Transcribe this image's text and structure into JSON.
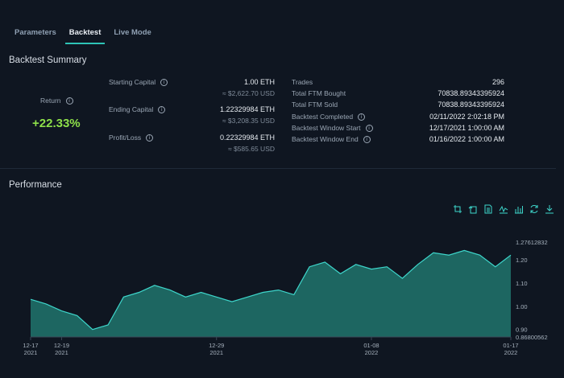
{
  "tabs": [
    {
      "label": "Parameters",
      "active": false
    },
    {
      "label": "Backtest",
      "active": true
    },
    {
      "label": "Live Mode",
      "active": false
    }
  ],
  "summary": {
    "title": "Backtest Summary",
    "return_label": "Return",
    "return_value": "+22.33%",
    "return_color": "#8ee04a",
    "capital": [
      {
        "label": "Starting Capital",
        "main": "1.00  ETH",
        "sub": "≈ $2,622.70 USD"
      },
      {
        "label": "Ending Capital",
        "main": "1.22329984  ETH",
        "sub": "≈ $3,208.35 USD"
      },
      {
        "label": "Profit/Loss",
        "main": "0.22329984  ETH",
        "sub": "≈ $585.65 USD"
      }
    ],
    "stats": [
      {
        "label": "Trades",
        "value": "296",
        "info": false
      },
      {
        "label": "Total FTM Bought",
        "value": "70838.89343395924",
        "info": false
      },
      {
        "label": "Total FTM Sold",
        "value": "70838.89343395924",
        "info": false
      },
      {
        "label": "Backtest Completed",
        "value": "02/11/2022 2:02:18 PM",
        "info": true
      },
      {
        "label": "Backtest Window Start",
        "value": "12/17/2021 1:00:00 AM",
        "info": true
      },
      {
        "label": "Backtest Window End",
        "value": "01/16/2022 1:00:00 AM",
        "info": true
      }
    ]
  },
  "performance": {
    "title": "Performance",
    "toolbar_icons": [
      "zoom-select-icon",
      "zoom-reset-icon",
      "data-view-icon",
      "line-chart-icon",
      "bar-chart-icon",
      "restore-icon",
      "download-icon"
    ]
  },
  "chart_data": {
    "type": "area",
    "x_start": "2021-12-17",
    "x_end": "2022-01-17",
    "x_ticks": [
      {
        "date": "2021-12-17",
        "line1": "12-17",
        "line2": "2021"
      },
      {
        "date": "2021-12-19",
        "line1": "12-19",
        "line2": "2021"
      },
      {
        "date": "2021-12-29",
        "line1": "12-29",
        "line2": "2021"
      },
      {
        "date": "2022-01-08",
        "line1": "01-08",
        "line2": "2022"
      },
      {
        "date": "2022-01-17",
        "line1": "01-17",
        "line2": "2022"
      }
    ],
    "y_min": 0.86800562,
    "y_max": 1.27612832,
    "y_min_label": "0.86800562",
    "y_max_label": "1.27612832",
    "y_ticks": [
      0.9,
      1.0,
      1.1,
      1.2
    ],
    "y_tick_labels": [
      "0.90",
      "1.00",
      "1.10",
      "1.20"
    ],
    "fill_color": "#1f6f68",
    "line_color": "#3ed6cb",
    "series": [
      {
        "x": [
          "2021-12-17",
          "2021-12-18",
          "2021-12-19",
          "2021-12-20",
          "2021-12-21",
          "2021-12-22",
          "2021-12-23",
          "2021-12-24",
          "2021-12-25",
          "2021-12-26",
          "2021-12-27",
          "2021-12-28",
          "2021-12-29",
          "2021-12-30",
          "2021-12-31",
          "2022-01-01",
          "2022-01-02",
          "2022-01-03",
          "2022-01-04",
          "2022-01-05",
          "2022-01-06",
          "2022-01-07",
          "2022-01-08",
          "2022-01-09",
          "2022-01-10",
          "2022-01-11",
          "2022-01-12",
          "2022-01-13",
          "2022-01-14",
          "2022-01-15",
          "2022-01-16",
          "2022-01-17"
        ],
        "values": [
          1.03,
          1.01,
          0.98,
          0.96,
          0.9,
          0.92,
          1.04,
          1.06,
          1.09,
          1.07,
          1.04,
          1.06,
          1.04,
          1.02,
          1.04,
          1.06,
          1.07,
          1.05,
          1.17,
          1.19,
          1.14,
          1.18,
          1.16,
          1.17,
          1.12,
          1.18,
          1.23,
          1.22,
          1.24,
          1.22,
          1.17,
          1.22
        ]
      }
    ]
  }
}
